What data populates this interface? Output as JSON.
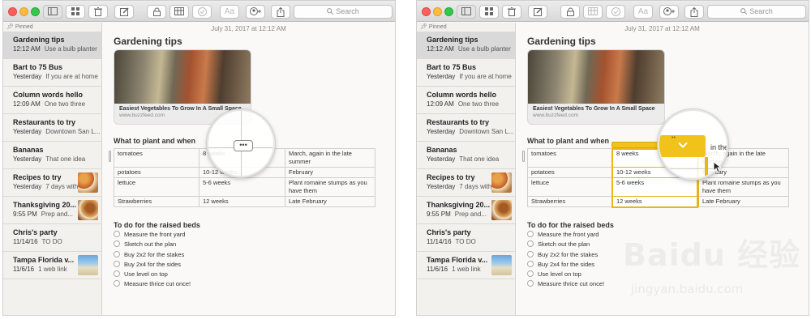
{
  "toolbar": {
    "font_button": "Aa",
    "search_placeholder": "Search"
  },
  "sidebar": {
    "pinned_label": "Pinned",
    "notes": [
      {
        "title": "Gardening tips",
        "date": "12:12 AM",
        "preview": "Use a bulb planter"
      },
      {
        "title": "Bart to 75 Bus",
        "date": "Yesterday",
        "preview": "If you are at home"
      },
      {
        "title": "Column words hello",
        "date": "12:09 AM",
        "preview": "One two three"
      },
      {
        "title": "Restaurants to try",
        "date": "Yesterday",
        "preview": "Downtown San L..."
      },
      {
        "title": "Bananas",
        "date": "Yesterday",
        "preview": "That one idea"
      },
      {
        "title": "Recipes to try",
        "date": "Yesterday",
        "preview": "7 days with n..."
      },
      {
        "title": "Thanksgiving 20...",
        "date": "9:55 PM",
        "preview": "Prep and..."
      },
      {
        "title": "Chris's party",
        "date": "11/14/16",
        "preview": "TO DO"
      },
      {
        "title": "Tampa Florida v...",
        "date": "11/6/16",
        "preview": "1 web link"
      }
    ]
  },
  "note": {
    "date": "July 31, 2017 at 12:12 AM",
    "title": "Gardening tips",
    "link_card": {
      "title": "Easiest Vegetables To Grow In A Small Space",
      "url": "www.buzzfeed.com"
    },
    "section1": "What to plant and when",
    "table": [
      [
        "tomatoes",
        "8 weeks",
        "March, again in the late summer"
      ],
      [
        "potatoes",
        "10-12 weeks",
        "February"
      ],
      [
        "lettuce",
        "5-6 weeks",
        "Plant romaine stumps as you have them"
      ],
      [
        "Strawberries",
        "12 weeks",
        "Late February"
      ]
    ],
    "section2": "To do for the raised beds",
    "todos": [
      "Measure the front yard",
      "Sketch out the plan",
      "Buy 2x2 for the stakes",
      "Buy 2x4 for the sides",
      "Use level on top",
      "Measure thrice cut once!"
    ]
  },
  "magnifier": {
    "more_button": "•••",
    "column_dots": "••",
    "right_text": "in the late"
  },
  "colors": {
    "selection": "#f0c21a",
    "traffic_red": "#fc605c",
    "traffic_yellow": "#fdbc40",
    "traffic_green": "#34c84a"
  },
  "watermark": {
    "logo": "Baidu 经验",
    "url": "jingyan.baidu.com"
  }
}
